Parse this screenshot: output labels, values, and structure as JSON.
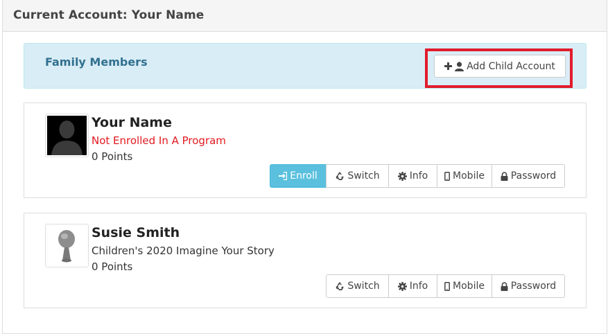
{
  "header": {
    "title": "Current Account: Your Name"
  },
  "family": {
    "title": "Family Members",
    "add_button_label": "Add Child Account"
  },
  "members": [
    {
      "name": "Your Name",
      "program": "Not Enrolled In A Program",
      "points": "0 Points",
      "buttons": {
        "enroll": "Enroll",
        "switch": "Switch",
        "info": "Info",
        "mobile": "Mobile",
        "password": "Password"
      }
    },
    {
      "name": "Susie Smith",
      "program": "Children's 2020 Imagine Your Story",
      "points": "0 Points",
      "buttons": {
        "switch": "Switch",
        "info": "Info",
        "mobile": "Mobile",
        "password": "Password"
      }
    }
  ],
  "colors": {
    "accent_info": "#5bc0de",
    "family_bar": "#d9edf7",
    "family_title": "#31708f",
    "highlight": "#e11c2b",
    "not_enrolled": "#e1191f"
  },
  "icons": {
    "add": "plus-icon",
    "user": "user-icon",
    "enroll": "sign-in-icon",
    "switch": "recycle-icon",
    "info": "gear-icon",
    "mobile": "mobile-icon",
    "password": "lock-icon"
  }
}
